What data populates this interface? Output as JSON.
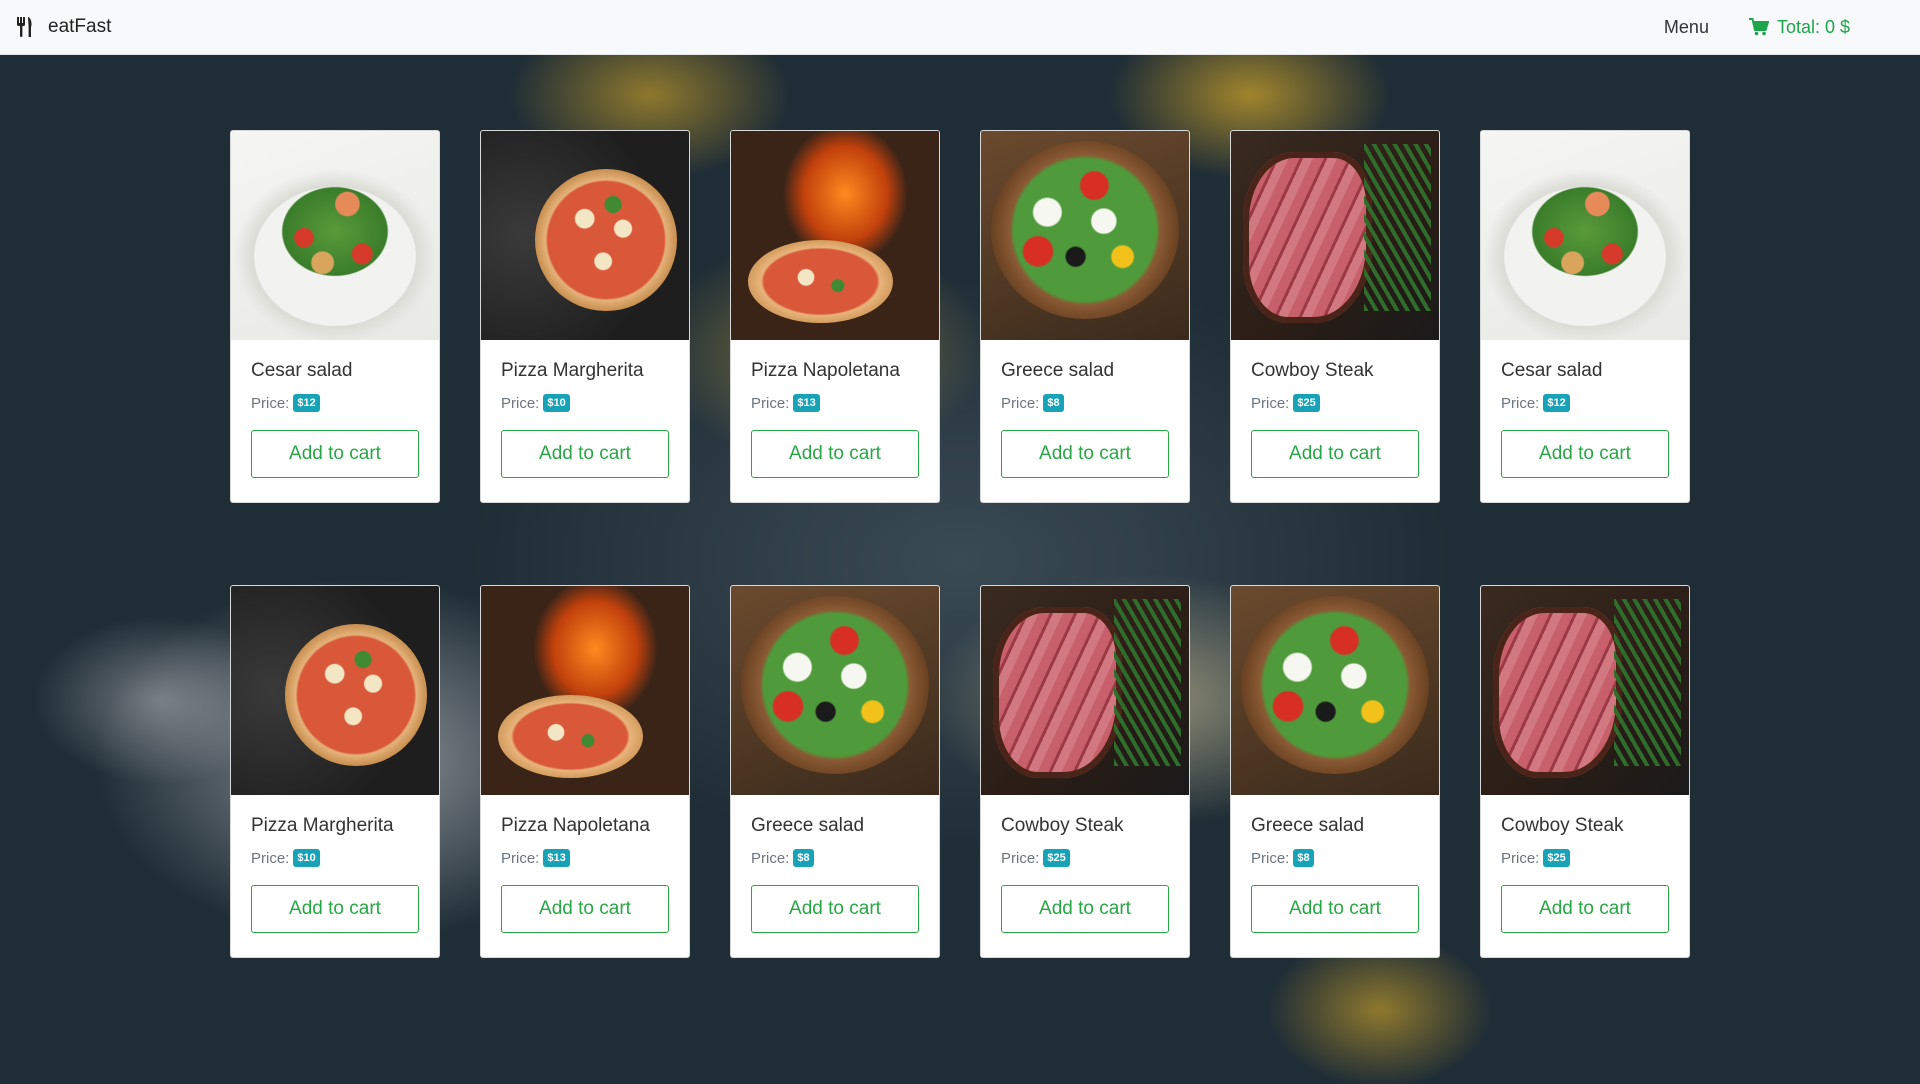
{
  "navbar": {
    "brand": "eatFast",
    "brand_icon": "utensils-icon",
    "menu_label": "Menu",
    "cart_icon": "shopping-cart-icon",
    "cart_total": "Total: 0 $",
    "accent_color": "#1ea44a"
  },
  "products": [
    {
      "name": "Cesar salad",
      "price_label": "Price:",
      "price": "$12",
      "button": "Add to cart",
      "image": "cesar-salad-image"
    },
    {
      "name": "Pizza Margherita",
      "price_label": "Price:",
      "price": "$10",
      "button": "Add to cart",
      "image": "pizza-margherita-image"
    },
    {
      "name": "Pizza Napoletana",
      "price_label": "Price:",
      "price": "$13",
      "button": "Add to cart",
      "image": "pizza-napoletana-image"
    },
    {
      "name": "Greece salad",
      "price_label": "Price:",
      "price": "$8",
      "button": "Add to cart",
      "image": "greece-salad-image"
    },
    {
      "name": "Cowboy Steak",
      "price_label": "Price:",
      "price": "$25",
      "button": "Add to cart",
      "image": "cowboy-steak-image"
    },
    {
      "name": "Cesar salad",
      "price_label": "Price:",
      "price": "$12",
      "button": "Add to cart",
      "image": "cesar-salad-image"
    },
    {
      "name": "Pizza Margherita",
      "price_label": "Price:",
      "price": "$10",
      "button": "Add to cart",
      "image": "pizza-margherita-image"
    },
    {
      "name": "Pizza Napoletana",
      "price_label": "Price:",
      "price": "$13",
      "button": "Add to cart",
      "image": "pizza-napoletana-image"
    },
    {
      "name": "Greece salad",
      "price_label": "Price:",
      "price": "$8",
      "button": "Add to cart",
      "image": "greece-salad-image"
    },
    {
      "name": "Cowboy Steak",
      "price_label": "Price:",
      "price": "$25",
      "button": "Add to cart",
      "image": "cowboy-steak-image"
    },
    {
      "name": "Greece salad",
      "price_label": "Price:",
      "price": "$8",
      "button": "Add to cart",
      "image": "greece-salad-image"
    },
    {
      "name": "Cowboy Steak",
      "price_label": "Price:",
      "price": "$25",
      "button": "Add to cart",
      "image": "cowboy-steak-image"
    }
  ],
  "colors": {
    "badge": "#17a2b8",
    "button": "#28a745"
  }
}
